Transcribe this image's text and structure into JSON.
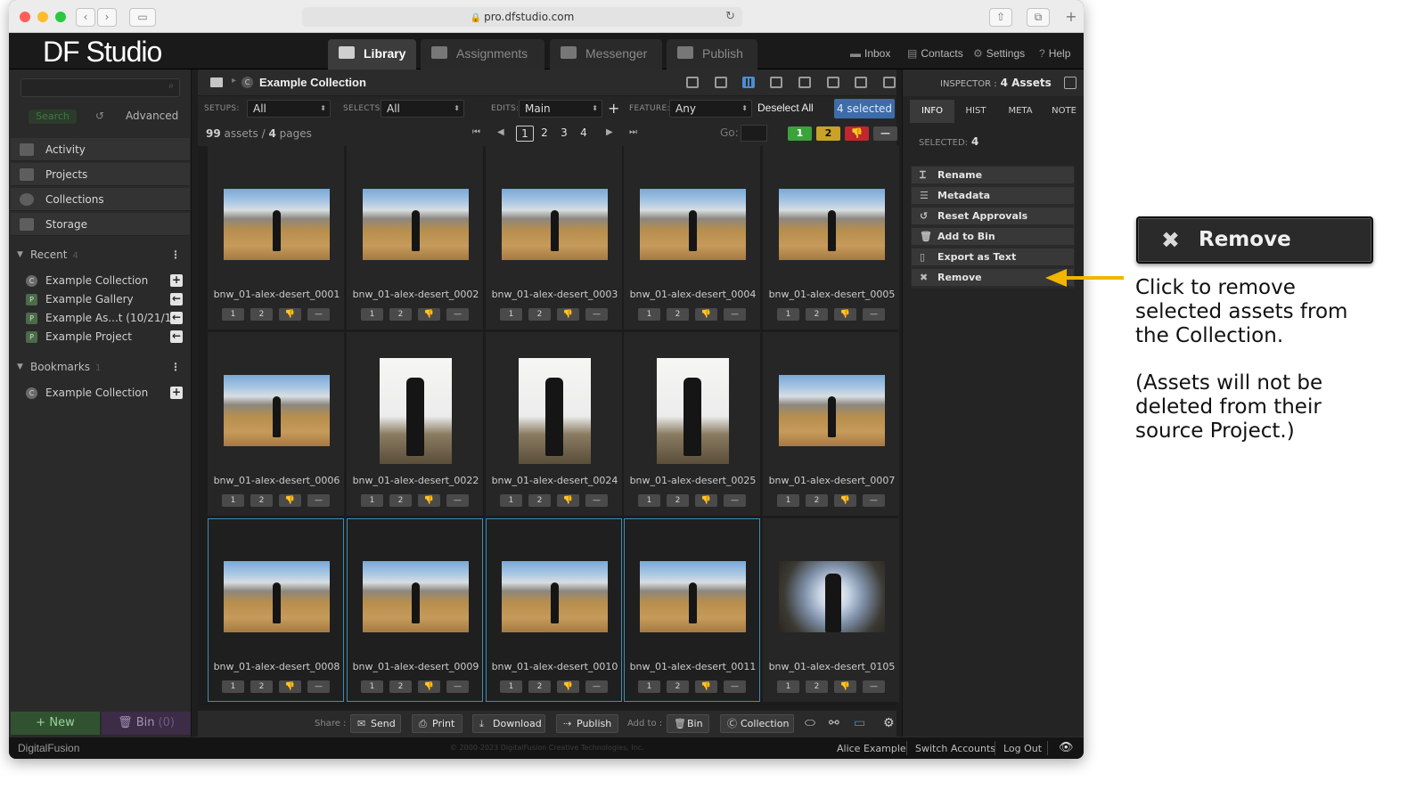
{
  "browser": {
    "url": "pro.dfstudio.com"
  },
  "app": {
    "logo": "DF Studio",
    "tabs": [
      "Library",
      "Assignments",
      "Messenger",
      "Publish"
    ],
    "top_links": [
      "Inbox",
      "Contacts",
      "Settings",
      "Help"
    ]
  },
  "sidebar": {
    "search_button": "Search",
    "advanced": "Advanced",
    "nav": [
      "Activity",
      "Projects",
      "Collections",
      "Storage"
    ],
    "recent": {
      "label": "Recent",
      "count": "4",
      "items": [
        {
          "badge": "C",
          "label": "Example Collection",
          "action": "+"
        },
        {
          "badge": "P",
          "label": "Example Gallery",
          "action": "←"
        },
        {
          "badge": "P",
          "label": "Example As...t (10/21/15)",
          "action": "←"
        },
        {
          "badge": "P",
          "label": "Example Project",
          "action": "←"
        }
      ]
    },
    "bookmarks": {
      "label": "Bookmarks",
      "count": "1",
      "items": [
        {
          "badge": "C",
          "label": "Example Collection",
          "action": "+"
        }
      ]
    },
    "new_button": "New",
    "bin_button": "Bin",
    "bin_count": "(0)"
  },
  "main": {
    "title": "Example Collection",
    "filters": {
      "setups_label": "SETUPS:",
      "setups_value": "All",
      "selects_label": "SELECTS:",
      "selects_value": "All",
      "edits_label": "EDITS:",
      "edits_value": "Main",
      "feature_label": "FEATURE:",
      "feature_value": "Any",
      "deselect": "Deselect All",
      "selected": "4 selected"
    },
    "pager": {
      "assets_count": "99",
      "assets_label": "assets",
      "pages_count": "4",
      "pages_label": "pages",
      "pages": [
        "1",
        "2",
        "3",
        "4"
      ],
      "current_page": "1",
      "go_label": "Go:"
    },
    "rating_filters": [
      "1",
      "2",
      "👎",
      "—"
    ],
    "assets": [
      {
        "name": "bnw_01-alex-desert_0001",
        "kind": "land",
        "selected": false
      },
      {
        "name": "bnw_01-alex-desert_0002",
        "kind": "land",
        "selected": false
      },
      {
        "name": "bnw_01-alex-desert_0003",
        "kind": "land",
        "selected": false
      },
      {
        "name": "bnw_01-alex-desert_0004",
        "kind": "land",
        "selected": false
      },
      {
        "name": "bnw_01-alex-desert_0005",
        "kind": "land",
        "selected": false
      },
      {
        "name": "bnw_01-alex-desert_0006",
        "kind": "land",
        "selected": false
      },
      {
        "name": "bnw_01-alex-desert_0022",
        "kind": "port",
        "selected": false
      },
      {
        "name": "bnw_01-alex-desert_0024",
        "kind": "port",
        "selected": false
      },
      {
        "name": "bnw_01-alex-desert_0025",
        "kind": "port",
        "selected": false
      },
      {
        "name": "bnw_01-alex-desert_0007",
        "kind": "land",
        "selected": false
      },
      {
        "name": "bnw_01-alex-desert_0008",
        "kind": "land",
        "selected": true
      },
      {
        "name": "bnw_01-alex-desert_0009",
        "kind": "land",
        "selected": true
      },
      {
        "name": "bnw_01-alex-desert_0010",
        "kind": "land",
        "selected": true
      },
      {
        "name": "bnw_01-alex-desert_0011",
        "kind": "land",
        "selected": true
      },
      {
        "name": "bnw_01-alex-desert_0105",
        "kind": "dusk",
        "selected": false
      }
    ],
    "cell_buttons": [
      "1",
      "2",
      "👎",
      "—"
    ],
    "share": {
      "share_label": "Share :",
      "send": "Send",
      "print": "Print",
      "download": "Download",
      "publish": "Publish",
      "add_to_label": "Add to :",
      "bin": "Bin",
      "collection": "Collection"
    }
  },
  "inspector": {
    "label": "INSPECTOR :",
    "value": "4 Assets",
    "tabs": [
      "INFO",
      "HIST",
      "META",
      "NOTE"
    ],
    "selected_label": "SELECTED:",
    "selected_value": "4",
    "actions": [
      "Rename",
      "Metadata",
      "Reset Approvals",
      "Add to Bin",
      "Export as Text",
      "Remove"
    ]
  },
  "footer": {
    "logo": "DigitalFusion",
    "copyright": "© 2000-2023 DigitalFusion Creative Technologies, Inc.",
    "user": "Alice Example",
    "switch": "Switch Accounts",
    "logout": "Log Out"
  },
  "callout": {
    "button": "Remove",
    "note1": "Click to remove selected assets from the Collection.",
    "note2": "(Assets will not be deleted from their source Project.)"
  },
  "colors": {
    "selection_border": "#3f8db4",
    "selected_badge": "#3d6ca8",
    "arrow": "#f4b400",
    "rating_green": "#3aa33a",
    "rating_yellow": "#c9a227",
    "rating_red": "#c0282d"
  }
}
